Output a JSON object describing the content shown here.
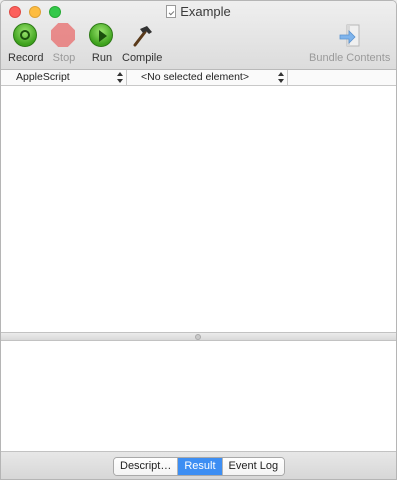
{
  "window": {
    "title": "Example"
  },
  "toolbar": {
    "record_label": "Record",
    "stop_label": "Stop",
    "run_label": "Run",
    "compile_label": "Compile",
    "bundle_contents_label": "Bundle Contents"
  },
  "navigation": {
    "language_value": "AppleScript",
    "element_value": "<No selected element>"
  },
  "bottom_tabs": {
    "items": [
      {
        "label": "Descript…",
        "active": false
      },
      {
        "label": "Result",
        "active": true
      },
      {
        "label": "Event Log",
        "active": false
      }
    ]
  },
  "colors": {
    "accent": "#3d8ef3",
    "record_green": "#3ea21d",
    "stop_red": "#e77a7a"
  }
}
